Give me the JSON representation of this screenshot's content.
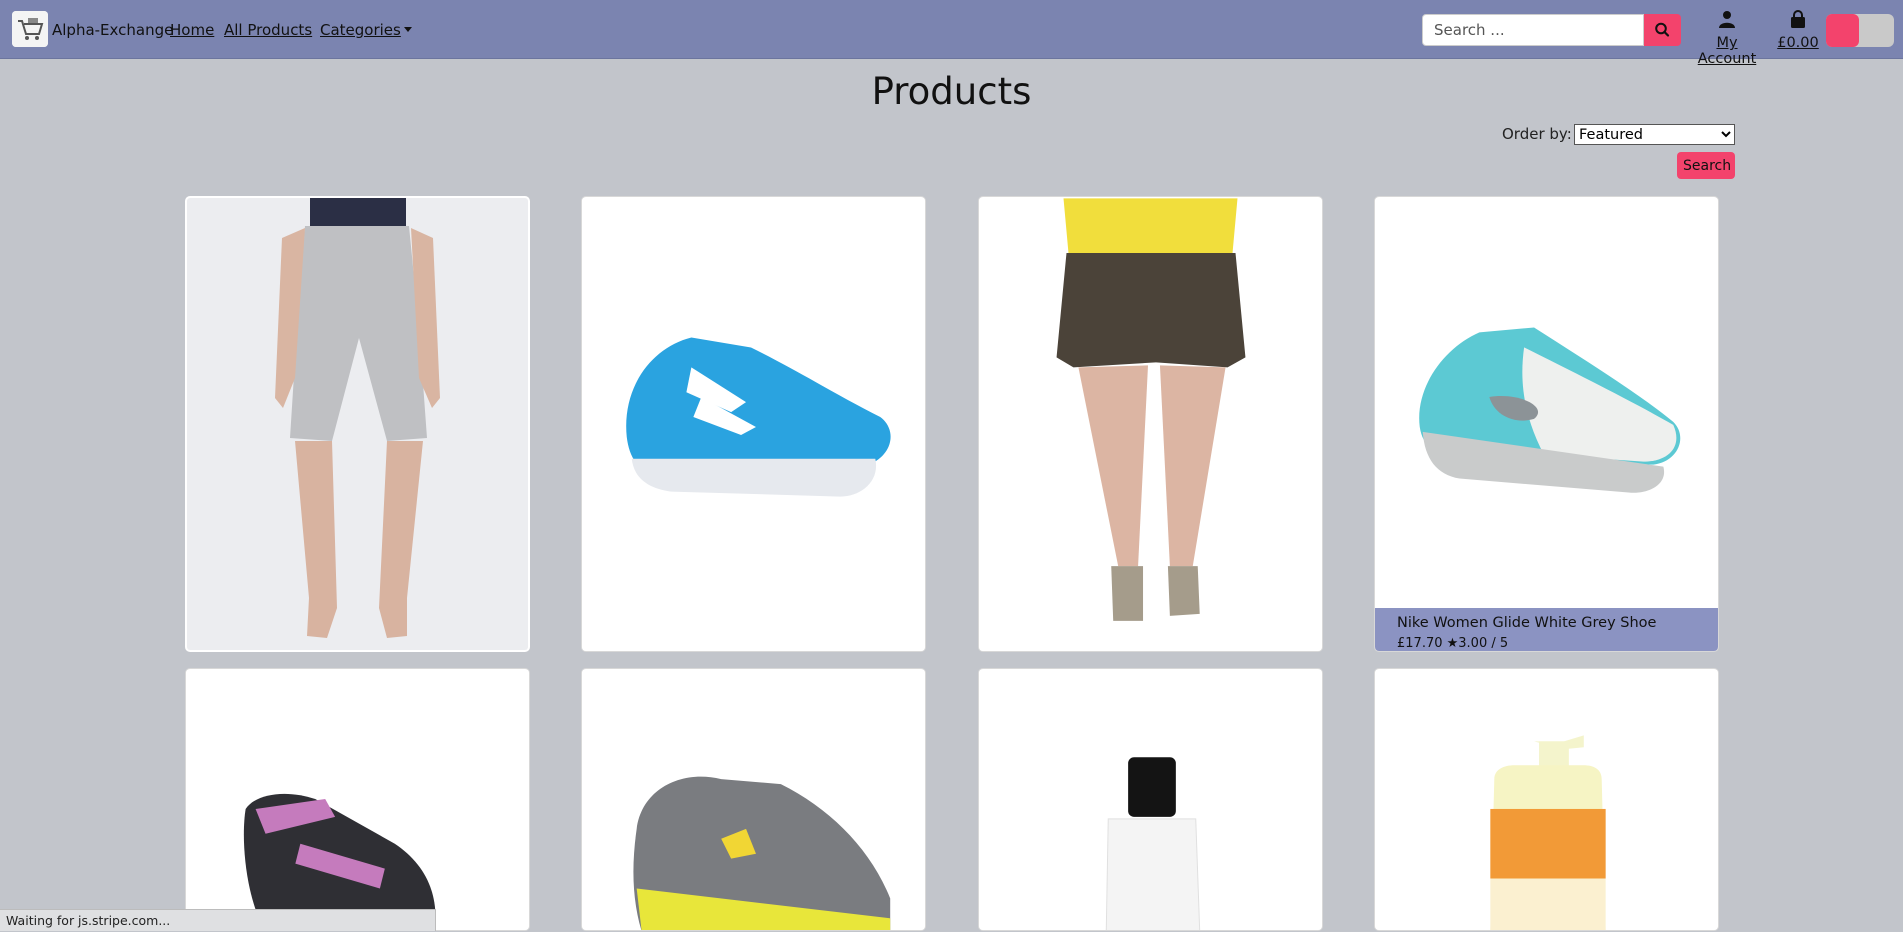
{
  "nav": {
    "brand": "Alpha-Exchange",
    "links": [
      {
        "label": "Home"
      },
      {
        "label": "All Products"
      },
      {
        "label": "Categories"
      }
    ],
    "search_placeholder": "Search ...",
    "account_label": "My Account",
    "cart_total": "£0.00",
    "accent_color": "#f3436c",
    "navbar_color": "#7b84b0"
  },
  "main": {
    "title": "Products",
    "order_by_label": "Order by:",
    "order_by_selected": "Featured",
    "search_button": "Search"
  },
  "products": [
    {
      "name": "",
      "image": "grey-shorts-photo"
    },
    {
      "name": "",
      "image": "blue-reebok-shoe-photo"
    },
    {
      "name": "",
      "image": "brown-shorts-photo"
    },
    {
      "name": "Nike Women Glide White Grey Shoe",
      "price": "£17.70  ★3.00 / 5",
      "image": "nike-teal-shoe-photo"
    },
    {
      "name": "",
      "image": "puma-sandal-photo"
    },
    {
      "name": "",
      "image": "nike-grey-yellow-shoe-photo"
    },
    {
      "name": "",
      "image": "white-bottle-photo"
    },
    {
      "name": "",
      "image": "lotus-lotion-photo"
    }
  ],
  "status_bar": "Waiting for js.stripe.com..."
}
